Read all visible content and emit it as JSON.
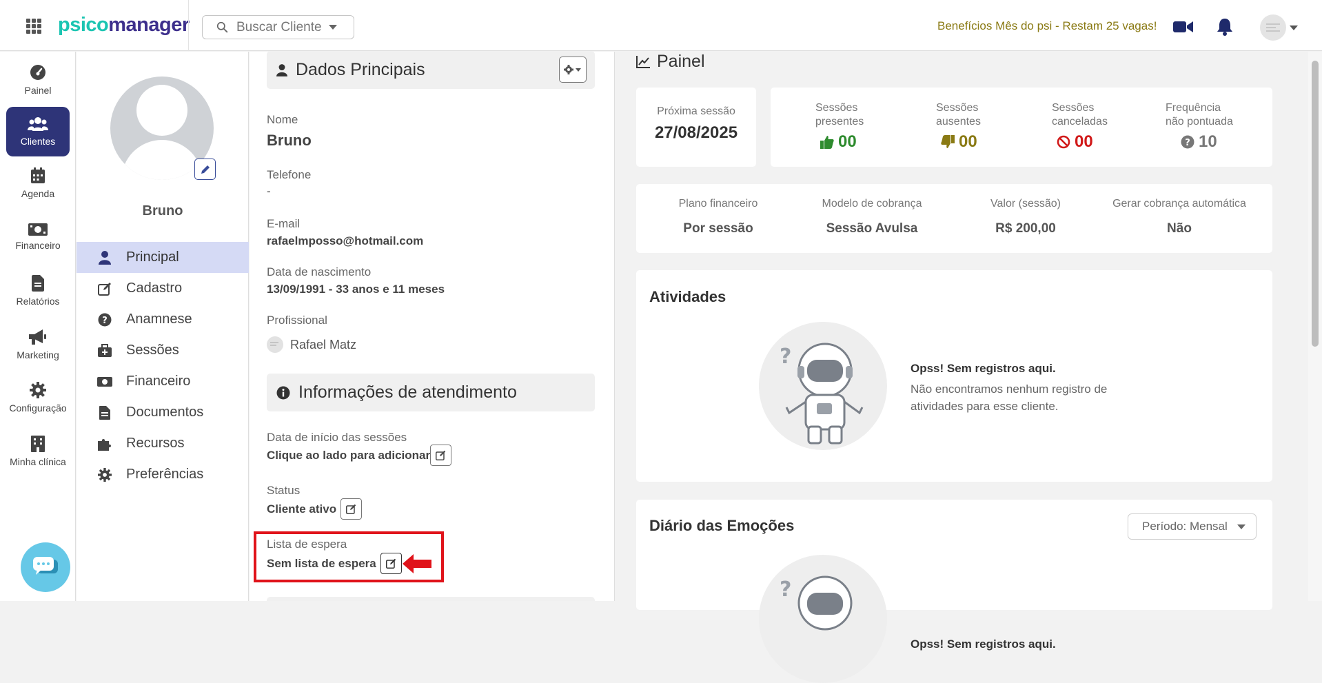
{
  "header": {
    "logo_part1": "psico",
    "logo_part2": "manager",
    "search_placeholder": "Buscar Cliente",
    "promo": "Benefícios Mês do psi - Restam 25 vagas!"
  },
  "leftnav": {
    "items": [
      {
        "label": "Painel",
        "icon": "dashboard-icon"
      },
      {
        "label": "Clientes",
        "icon": "users-icon"
      },
      {
        "label": "Agenda",
        "icon": "calendar-icon"
      },
      {
        "label": "Financeiro",
        "icon": "money-icon"
      },
      {
        "label": "Relatórios",
        "icon": "file-icon"
      },
      {
        "label": "Marketing",
        "icon": "megaphone-icon"
      },
      {
        "label": "Configuração",
        "icon": "gear-icon"
      },
      {
        "label": "Minha clínica",
        "icon": "building-icon"
      }
    ]
  },
  "profile": {
    "name": "Bruno",
    "menu": [
      {
        "label": "Principal",
        "icon": "user-icon"
      },
      {
        "label": "Cadastro",
        "icon": "edit-icon"
      },
      {
        "label": "Anamnese",
        "icon": "question-icon"
      },
      {
        "label": "Sessões",
        "icon": "briefcase-medical-icon"
      },
      {
        "label": "Financeiro",
        "icon": "money-icon"
      },
      {
        "label": "Documentos",
        "icon": "document-icon"
      },
      {
        "label": "Recursos",
        "icon": "puzzle-icon"
      },
      {
        "label": "Preferências",
        "icon": "gear-icon"
      }
    ]
  },
  "details": {
    "main_title": "Dados Principais",
    "fields": {
      "nome_label": "Nome",
      "nome_value": "Bruno",
      "telefone_label": "Telefone",
      "telefone_value": "-",
      "email_label": "E-mail",
      "email_value": "rafaelmposso@hotmail.com",
      "nascimento_label": "Data de nascimento",
      "nascimento_value": "13/09/1991 - 33 anos e 11 meses",
      "profissional_label": "Profissional",
      "profissional_value": "Rafael Matz"
    },
    "atendimento_title": "Informações de atendimento",
    "atendimento": {
      "inicio_label": "Data de início das sessões",
      "inicio_value": "Clique ao lado para adicionar",
      "status_label": "Status",
      "status_value": "Cliente ativo",
      "espera_label": "Lista de espera",
      "espera_value": "Sem lista de espera"
    }
  },
  "painel": {
    "title": "Painel",
    "proxima_label": "Próxima sessão",
    "proxima_value": "27/08/2025",
    "stats": [
      {
        "label1": "Sessões",
        "label2": "presentes",
        "value": "00",
        "color": "#2e8b2e",
        "icon": "thumbs-up-icon"
      },
      {
        "label1": "Sessões",
        "label2": "ausentes",
        "value": "00",
        "color": "#8a7a14",
        "icon": "thumbs-down-icon"
      },
      {
        "label1": "Sessões",
        "label2": "canceladas",
        "value": "00",
        "color": "#d11a1a",
        "icon": "ban-icon"
      },
      {
        "label1": "Frequência",
        "label2": "não pontuada",
        "value": "10",
        "color": "#777777",
        "icon": "question-circle-icon"
      }
    ],
    "financeiro": [
      {
        "label": "Plano financeiro",
        "value": "Por sessão"
      },
      {
        "label": "Modelo de cobrança",
        "value": "Sessão Avulsa"
      },
      {
        "label": "Valor (sessão)",
        "value": "R$ 200,00"
      },
      {
        "label": "Gerar cobrança automática",
        "value": "Não"
      }
    ],
    "atividades_title": "Atividades",
    "empty_title": "Opss! Sem registros aqui.",
    "empty_desc": "Não encontramos nenhum registro de atividades para esse cliente.",
    "diario_title": "Diário das Emoções",
    "periodo": "Período: Mensal",
    "empty_title_2": "Opss! Sem registros aqui."
  }
}
